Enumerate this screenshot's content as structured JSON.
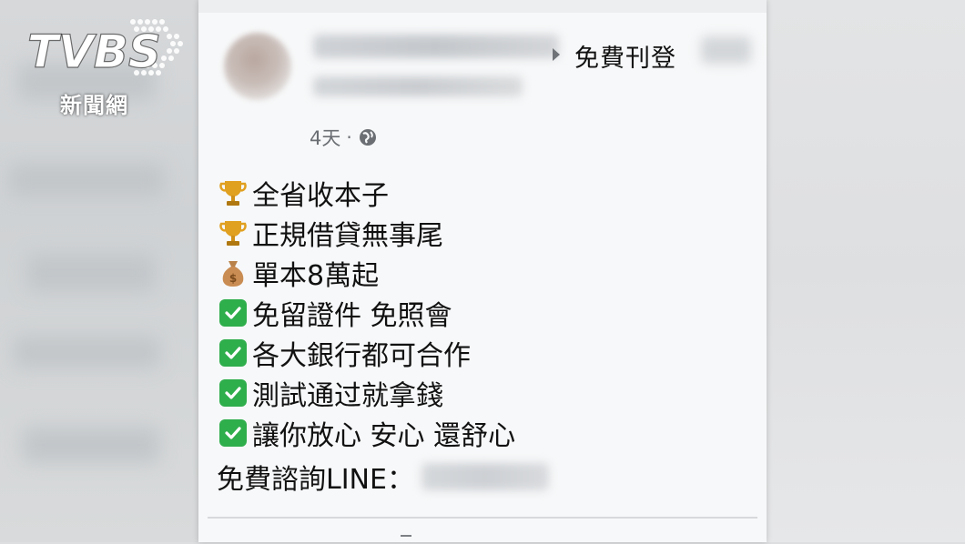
{
  "watermark": {
    "brand": "TVBS",
    "subtitle": "新聞網"
  },
  "post": {
    "group_name": "免費刊登",
    "time": "4天",
    "separator": "·",
    "privacy_icon": "globe-icon",
    "lines": [
      {
        "icon": "trophy-icon",
        "text": "全省收本子"
      },
      {
        "icon": "trophy-icon",
        "text": "正規借貸無事尾"
      },
      {
        "icon": "money-bag-icon",
        "text": "單本8萬起"
      },
      {
        "icon": "check-box-icon",
        "text": "免留證件 免照會"
      },
      {
        "icon": "check-box-icon",
        "text": "各大銀行都可合作"
      },
      {
        "icon": "check-box-icon",
        "text": "測試通过就拿錢"
      },
      {
        "icon": "check-box-icon",
        "text": "讓你放心 安心 還舒心"
      }
    ],
    "consult_label": "免費諮詢LINE："
  },
  "colors": {
    "check_green": "#2fae4c",
    "trophy_gold": "#e0a020",
    "card_bg": "#f7f8f9"
  }
}
